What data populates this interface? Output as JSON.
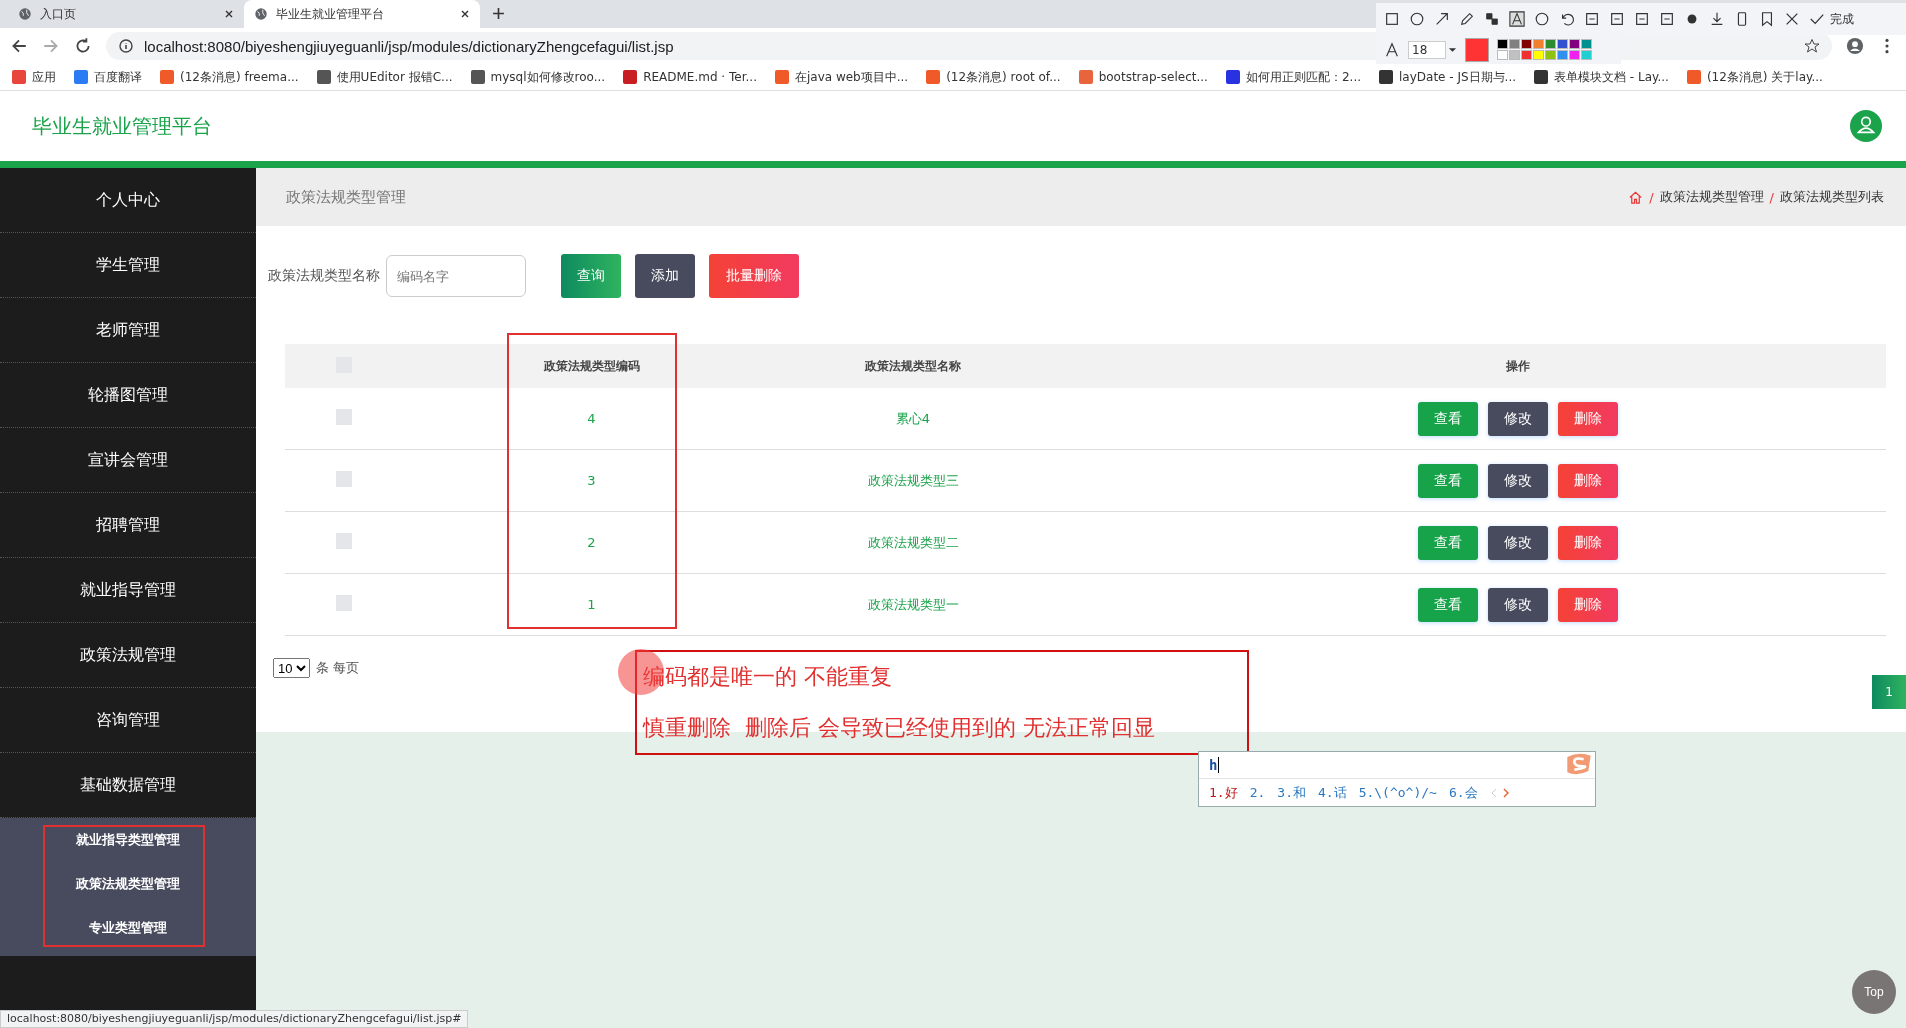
{
  "browser": {
    "tabs": [
      {
        "title": "入口页",
        "selected": false
      },
      {
        "title": "毕业生就业管理平台",
        "selected": true
      }
    ],
    "address": "localhost:8080/biyeshengjiuyeguanli/jsp/modules/dictionaryZhengcefagui/list.jsp",
    "bookmarks": [
      {
        "label": "应用",
        "color": "#e8453c"
      },
      {
        "label": "百度翻译",
        "color": "#2b7bf3"
      },
      {
        "label": "(12条消息) freema...",
        "color": "#f05a28"
      },
      {
        "label": "使用UEditor 报错C...",
        "color": "#555555"
      },
      {
        "label": "mysql如何修改roo...",
        "color": "#555555"
      },
      {
        "label": "README.md · Ter...",
        "color": "#c71d23"
      },
      {
        "label": "在java web项目中...",
        "color": "#f05a28"
      },
      {
        "label": "(12条消息) root of...",
        "color": "#f05a28"
      },
      {
        "label": "bootstrap-select...",
        "color": "#e8643c"
      },
      {
        "label": "如何用正则匹配：2...",
        "color": "#2932e1"
      },
      {
        "label": "layDate - JS日期与...",
        "color": "#333333"
      },
      {
        "label": "表单模块文档 - Lay...",
        "color": "#333333"
      },
      {
        "label": "(12条消息) 关于lay...",
        "color": "#f05a28"
      }
    ],
    "status_url": "localhost:8080/biyeshengjiuyeguanli/jsp/modules/dictionaryZhengcefagui/list.jsp#"
  },
  "capture_toolbar": {
    "done_label": "完成",
    "font_size": "18",
    "current": {
      "color": "#ff3333"
    },
    "palette": [
      {
        "color": "#000000"
      },
      {
        "color": "#808080"
      },
      {
        "color": "#800000"
      },
      {
        "color": "#f08030"
      },
      {
        "color": "#2e8b2e"
      },
      {
        "color": "#3050d0"
      },
      {
        "color": "#800080"
      },
      {
        "color": "#009090"
      },
      {
        "color": "#ffffff"
      },
      {
        "color": "#c0c0c0"
      },
      {
        "color": "#f03030"
      },
      {
        "color": "#ffff00"
      },
      {
        "color": "#90c010"
      },
      {
        "color": "#3090f0"
      },
      {
        "color": "#f020f0"
      },
      {
        "color": "#20d0d0"
      }
    ]
  },
  "app": {
    "title": "毕业生就业管理平台",
    "sidebar": {
      "items": [
        {
          "label": "个人中心"
        },
        {
          "label": "学生管理"
        },
        {
          "label": "老师管理"
        },
        {
          "label": "轮播图管理"
        },
        {
          "label": "宣讲会管理"
        },
        {
          "label": "招聘管理"
        },
        {
          "label": "就业指导管理"
        },
        {
          "label": "政策法规管理"
        },
        {
          "label": "咨询管理"
        },
        {
          "label": "基础数据管理",
          "children": [
            {
              "label": "就业指导类型管理"
            },
            {
              "label": "政策法规类型管理"
            },
            {
              "label": "专业类型管理"
            }
          ]
        }
      ]
    },
    "page_title": "政策法规类型管理",
    "breadcrumb": [
      {
        "separator": "/",
        "label": "政策法规类型管理"
      },
      {
        "separator": "/",
        "label": "政策法规类型列表"
      }
    ],
    "search": {
      "label": "政策法规类型名称",
      "placeholder": "编码名字",
      "buttons": [
        {
          "label": "查询",
          "kind": "query"
        },
        {
          "label": "添加",
          "kind": "add"
        },
        {
          "label": "批量删除",
          "kind": "batch-delete"
        }
      ]
    },
    "table": {
      "header_checked": false,
      "columns": [
        "政策法规类型编码",
        "政策法规类型名称",
        "操作"
      ],
      "rows": [
        {
          "checked": false,
          "code": "4",
          "name": "累心4",
          "actions": [
            {
              "label": "查看",
              "kind": "view"
            },
            {
              "label": "修改",
              "kind": "edit"
            },
            {
              "label": "删除",
              "kind": "delete"
            }
          ]
        },
        {
          "checked": false,
          "code": "3",
          "name": "政策法规类型三",
          "actions": [
            {
              "label": "查看",
              "kind": "view"
            },
            {
              "label": "修改",
              "kind": "edit"
            },
            {
              "label": "删除",
              "kind": "delete"
            }
          ]
        },
        {
          "checked": false,
          "code": "2",
          "name": "政策法规类型二",
          "actions": [
            {
              "label": "查看",
              "kind": "view"
            },
            {
              "label": "修改",
              "kind": "edit"
            },
            {
              "label": "删除",
              "kind": "delete"
            }
          ]
        },
        {
          "checked": false,
          "code": "1",
          "name": "政策法规类型一",
          "actions": [
            {
              "label": "查看",
              "kind": "view"
            },
            {
              "label": "修改",
              "kind": "edit"
            },
            {
              "label": "删除",
              "kind": "delete"
            }
          ]
        }
      ]
    },
    "pagination": {
      "page_size": "10",
      "page_size_suffix": "条 每页",
      "pages": [
        {
          "label": "1",
          "selected": true
        }
      ]
    },
    "top_button": "Top"
  },
  "annotation": {
    "lines": [
      "编码都是唯一的 不能重复",
      "慎重删除  删除后 会导致已经使用到的 无法正常回显"
    ]
  },
  "ime": {
    "input": "h",
    "candidates": [
      {
        "label": "1.好",
        "selected": true
      },
      {
        "label": "2.",
        "selected": false
      },
      {
        "label": "3.和",
        "selected": false
      },
      {
        "label": "4.话",
        "selected": false
      },
      {
        "label": "5.\\(^o^)/~",
        "selected": false
      },
      {
        "label": "6.会",
        "selected": false
      }
    ]
  }
}
